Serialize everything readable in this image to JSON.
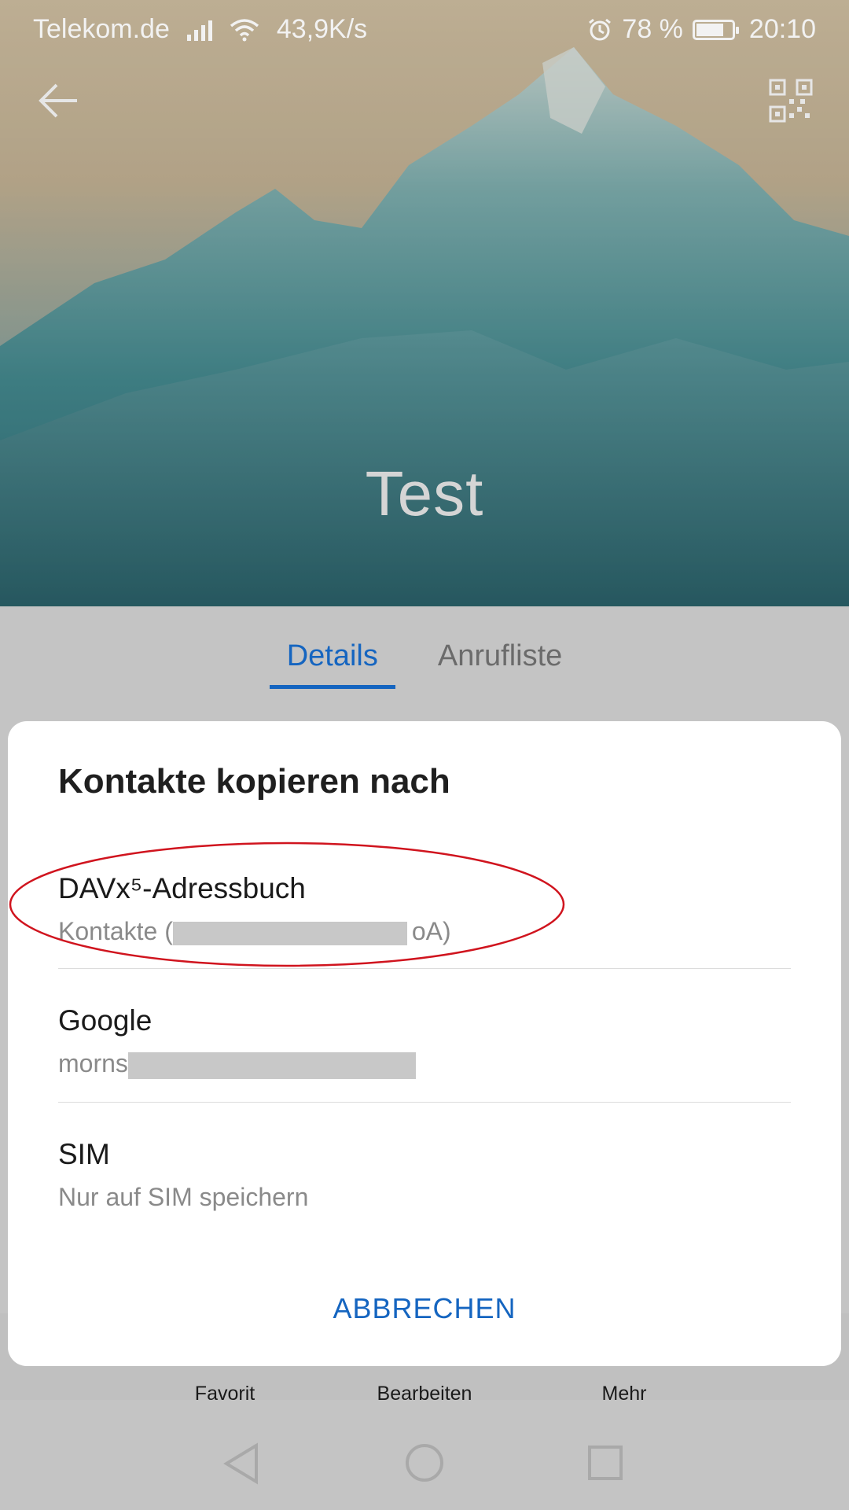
{
  "status_bar": {
    "carrier": "Telekom.de",
    "speed": "43,9K/s",
    "battery": "78 %",
    "time": "20:10",
    "battery_level": 0.78
  },
  "header": {
    "back_icon": "arrow-left-icon",
    "qr_icon": "qr-code-icon",
    "contact_name": "Test"
  },
  "tabs": [
    {
      "label": "Details",
      "active": true
    },
    {
      "label": "Anrufliste",
      "active": false
    }
  ],
  "action_bar": {
    "items": [
      {
        "label": "Favorit",
        "icon": "star-icon"
      },
      {
        "label": "Bearbeiten",
        "icon": "edit-icon"
      },
      {
        "label": "Mehr",
        "icon": "more-icon"
      }
    ]
  },
  "dialog": {
    "title": "Kontakte kopieren nach",
    "options": [
      {
        "primary": "DAVx⁵-Adressbuch",
        "secondary_prefix": "Kontakte (",
        "secondary_suffix": "oA)"
      },
      {
        "primary": "Google",
        "secondary_prefix": "morns",
        "secondary_suffix": ""
      },
      {
        "primary": "SIM",
        "secondary_prefix": "Nur auf SIM speichern",
        "secondary_suffix": ""
      }
    ],
    "cancel_label": "ABBRECHEN"
  },
  "colors": {
    "accent": "#1565c0",
    "annotation": "#d0141e"
  }
}
